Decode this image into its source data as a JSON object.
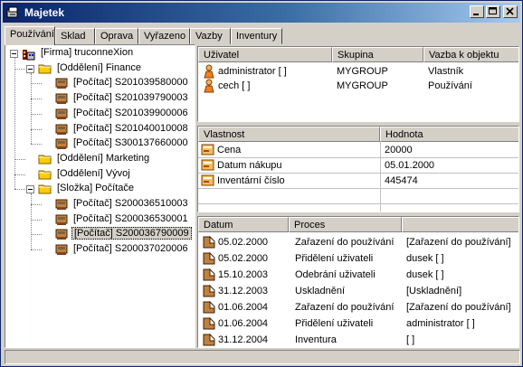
{
  "window": {
    "title": "Majetek"
  },
  "tabs": [
    {
      "label": "Používání",
      "active": true
    },
    {
      "label": "Sklad"
    },
    {
      "label": "Oprava"
    },
    {
      "label": "Vyřazeno"
    },
    {
      "label": "Vazby"
    },
    {
      "label": "Inventury"
    }
  ],
  "tree": {
    "items": [
      {
        "label": "[Firma] truconneXion",
        "icon": "company-icon",
        "expanded": true
      },
      {
        "label": "[Oddělení] Finance",
        "icon": "folder-icon",
        "expanded": true
      },
      {
        "label": "[Počítač] S201039580000",
        "icon": "computer-icon"
      },
      {
        "label": "[Počítač] S201039790003",
        "icon": "computer-icon"
      },
      {
        "label": "[Počítač] S201039900006",
        "icon": "computer-icon"
      },
      {
        "label": "[Počítač] S201040010008",
        "icon": "computer-icon"
      },
      {
        "label": "[Počítač] S300137660000",
        "icon": "computer-icon"
      },
      {
        "label": "[Oddělení] Marketing",
        "icon": "folder-icon"
      },
      {
        "label": "[Oddělení] Vývoj",
        "icon": "folder-icon"
      },
      {
        "label": "[Složka] Počítače",
        "icon": "folder-icon",
        "expanded": true
      },
      {
        "label": "[Počítač] S200036510003",
        "icon": "computer-icon"
      },
      {
        "label": "[Počítač] S200036530001",
        "icon": "computer-icon"
      },
      {
        "label": "[Počítač] S200036790009",
        "icon": "computer-icon",
        "selected": true
      },
      {
        "label": "[Počítač] S200037020006",
        "icon": "computer-icon"
      }
    ]
  },
  "users_table": {
    "headers": [
      "Uživatel",
      "Skupina",
      "Vazba k objektu"
    ],
    "rows": [
      {
        "user": "administrator [ ]",
        "group": "MYGROUP",
        "relation": "Vlastník",
        "icon": "user-icon"
      },
      {
        "user": "cech [ ]",
        "group": "MYGROUP",
        "relation": "Používání",
        "icon": "user-icon"
      }
    ]
  },
  "props_table": {
    "headers": [
      "Vlastnost",
      "Hodnota"
    ],
    "rows": [
      {
        "name": "Cena",
        "value": "20000",
        "icon": "property-icon"
      },
      {
        "name": "Datum nákupu",
        "value": "05.01.2000",
        "icon": "property-icon"
      },
      {
        "name": "Inventární číslo",
        "value": "445474",
        "icon": "property-icon"
      }
    ]
  },
  "history_table": {
    "headers": [
      "Datum",
      "Proces"
    ],
    "rows": [
      {
        "date": "05.02.2000",
        "process": "Zařazení do používání",
        "detail": "[Zařazení do používání]"
      },
      {
        "date": "05.02.2000",
        "process": "Přidělení uživateli",
        "detail": "dusek [ ]"
      },
      {
        "date": "15.10.2003",
        "process": "Odebrání uživateli",
        "detail": "dusek [ ]"
      },
      {
        "date": "31.12.2003",
        "process": "Uskladnění",
        "detail": "[Uskladnění]"
      },
      {
        "date": "01.06.2004",
        "process": "Zařazení do používání",
        "detail": "[Zařazení do používání]"
      },
      {
        "date": "01.06.2004",
        "process": "Přidělení uživateli",
        "detail": "administrator [ ]"
      },
      {
        "date": "31.12.2004",
        "process": "Inventura",
        "detail": "[ ]"
      }
    ]
  },
  "colors": {
    "titlebar_start": "#0a246a",
    "titlebar_end": "#a6caf0",
    "face": "#d4d0c8"
  }
}
